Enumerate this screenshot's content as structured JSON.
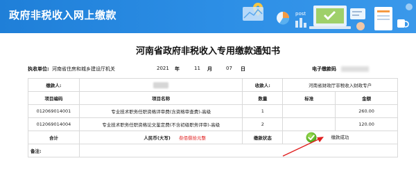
{
  "banner": {
    "title": "政府非税收入网上缴款"
  },
  "notice": {
    "title": "河南省政府非税收入专用缴款通知书",
    "exec_unit_label": "执收单位:",
    "exec_unit_value": "河南省住房和城乡建设厅机关",
    "year": "2021",
    "year_unit": "年",
    "month": "11",
    "month_unit": "月",
    "day": "07",
    "day_unit": "日",
    "e_ticket_label": "电子缴款码"
  },
  "table": {
    "payer_label": "缴款人:",
    "payee_label": "收款人:",
    "payee_value": "河南省财政厅非税收入财政专户",
    "headers": [
      "项目编码",
      "项目名称",
      "数量",
      "标准",
      "金额"
    ],
    "rows": [
      {
        "code": "012069014001",
        "name": "专业技术职务任职资格评审费(含资格审查费)-高级",
        "qty": "1",
        "std": "",
        "amount": "260.00"
      },
      {
        "code": "012069014004",
        "name": "专业技术职务任职资格论文鉴定费(不含初级职务评审)-高级",
        "qty": "2",
        "std": "",
        "amount": "120.00"
      }
    ],
    "total_label": "合计",
    "rmb_label": "人民币(大写)",
    "rmb_value": "叁佰捌拾元整",
    "status_label": "缴款状态",
    "status_value": "缴款成功",
    "remark_label": "备注:"
  },
  "colors": {
    "banner": "#2d8fe6",
    "accent_red": "#e02020",
    "success_green": "#4caf1a"
  }
}
